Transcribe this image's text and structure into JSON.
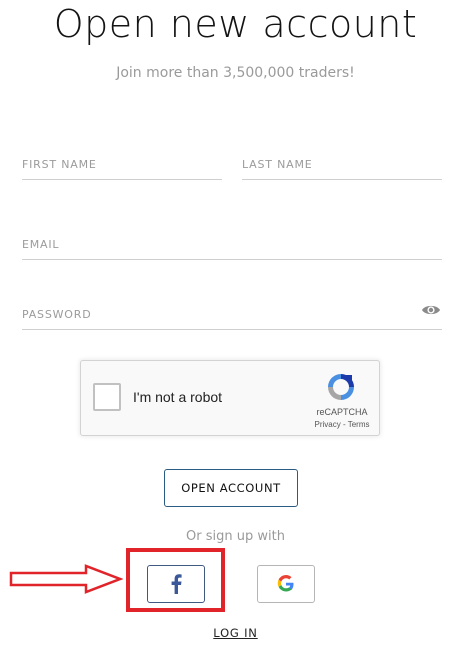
{
  "header": {
    "title": "Open new account",
    "subtitle": "Join more than 3,500,000 traders!"
  },
  "form": {
    "first_name_placeholder": "FIRST NAME",
    "last_name_placeholder": "LAST NAME",
    "email_placeholder": "EMAIL",
    "password_placeholder": "PASSWORD",
    "show_password_icon": "eye-icon"
  },
  "captcha": {
    "label": "I'm not a robot",
    "brand": "reCAPTCHA",
    "links": "Privacy - Terms",
    "checked": false
  },
  "actions": {
    "open_account_label": "OPEN ACCOUNT",
    "or_sign_up_label": "Or sign up with",
    "facebook_icon": "facebook-icon",
    "google_icon": "google-icon",
    "login_label": "LOG IN"
  },
  "annotation": {
    "color": "#e0242a",
    "highlighted": "facebook-button"
  },
  "colors": {
    "button_border": "#2b5a82",
    "facebook_blue": "#3b5998",
    "muted_text": "#9a9a9a"
  }
}
